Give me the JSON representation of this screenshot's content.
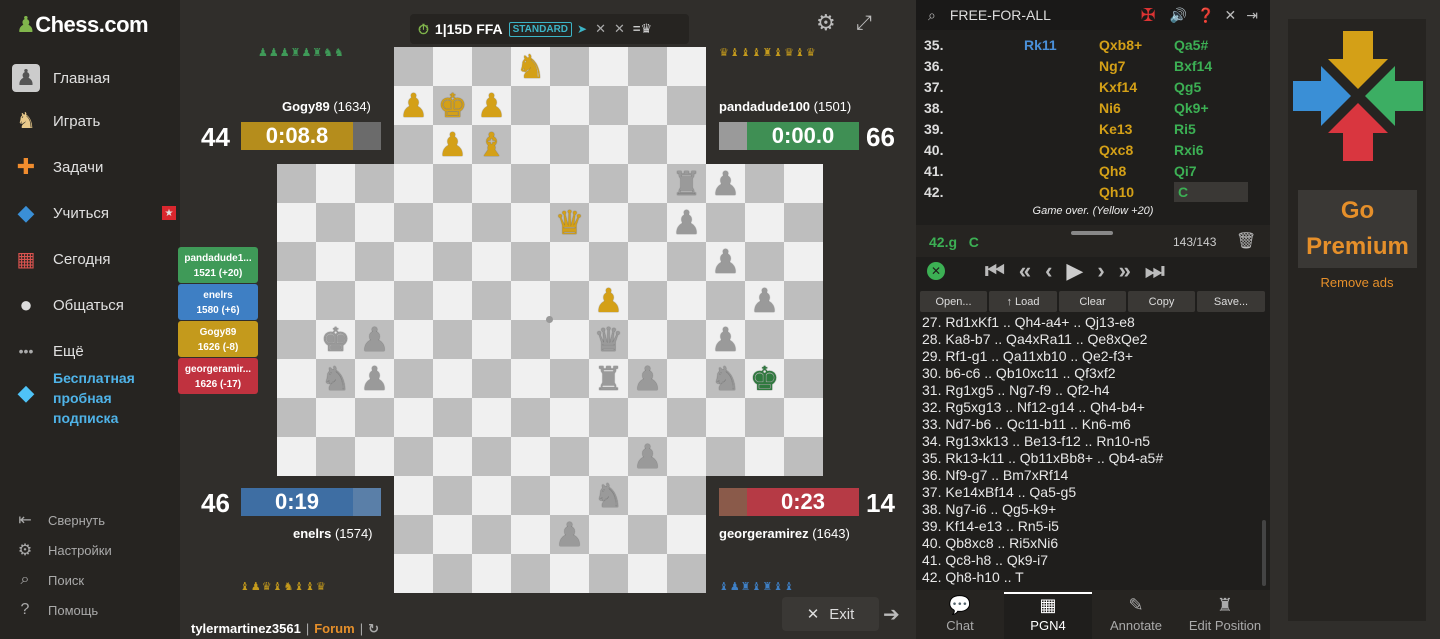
{
  "sidebar": {
    "logo": "Chess.com",
    "items": [
      {
        "label": "Главная",
        "icon": "home-icon"
      },
      {
        "label": "Играть",
        "icon": "play-icon"
      },
      {
        "label": "Задачи",
        "icon": "puzzle-icon"
      },
      {
        "label": "Учиться",
        "icon": "learn-icon"
      },
      {
        "label": "Сегодня",
        "icon": "today-icon"
      },
      {
        "label": "Общаться",
        "icon": "social-icon"
      },
      {
        "label": "Ещё",
        "icon": "more-icon"
      }
    ],
    "premium_label": "Бесплатная пробная подписка",
    "bottom": [
      {
        "label": "Свернуть",
        "icon": "collapse-icon"
      },
      {
        "label": "Настройки",
        "icon": "settings-icon"
      },
      {
        "label": "Поиск",
        "icon": "search-icon"
      },
      {
        "label": "Помощь",
        "icon": "help-icon"
      }
    ]
  },
  "game_header": {
    "title": "1|15D FFA",
    "badge": "STANDARD",
    "suffix": "=♛"
  },
  "players": {
    "top_left": {
      "name": "Gogy89",
      "rating": "(1634)",
      "score": "44",
      "clock": "0:08.8",
      "color": "#b58d1c"
    },
    "top_right": {
      "name": "pandadude100",
      "rating": "(1501)",
      "score": "66",
      "clock": "0:00.0",
      "color": "#3f8f54"
    },
    "bottom_left": {
      "name": "enelrs",
      "rating": "(1574)",
      "score": "46",
      "clock": "0:19",
      "color": "#3e6ea3"
    },
    "bottom_right": {
      "name": "georgeramirez",
      "rating": "(1643)",
      "score": "14",
      "clock": "0:23",
      "color": "#b63a45"
    }
  },
  "rankings": [
    {
      "name": "pandadude1...",
      "result": "1521 (+20)",
      "color": "#3f9a58"
    },
    {
      "name": "enelrs",
      "result": "1580 (+6)",
      "color": "#3e7fc4"
    },
    {
      "name": "Gogy89",
      "result": "1626 (-8)",
      "color": "#c49a1c"
    },
    {
      "name": "georgeramir...",
      "result": "1626 (-17)",
      "color": "#c0323f"
    }
  ],
  "material_rows": {
    "top_left": "♟♟♟♜♟♜♞♞",
    "top_right": "♛♝♝♝♜♝♛♝♛",
    "bottom_left": "♝♟♛♝♞♝♝♛",
    "bottom_right": "♝♟♜♝♜♝♝"
  },
  "footer": {
    "username": "tylermartinez3561",
    "separator": "|",
    "forum": "Forum",
    "exit": "Exit"
  },
  "right_panel": {
    "mode": "FREE-FOR-ALL",
    "moves": [
      {
        "n": "35.",
        "b": "Rk11",
        "y": "Qxb8+",
        "g": "Qa5#"
      },
      {
        "n": "36.",
        "b": "",
        "y": "Ng7",
        "g": "Bxf14"
      },
      {
        "n": "37.",
        "b": "",
        "y": "Kxf14",
        "g": "Qg5"
      },
      {
        "n": "38.",
        "b": "",
        "y": "Ni6",
        "g": "Qk9+"
      },
      {
        "n": "39.",
        "b": "",
        "y": "Ke13",
        "g": "Ri5"
      },
      {
        "n": "40.",
        "b": "",
        "y": "Qxc8",
        "g": "Rxi6"
      },
      {
        "n": "41.",
        "b": "",
        "y": "Qh8",
        "g": "Qi7"
      },
      {
        "n": "42.",
        "b": "",
        "y": "Qh10",
        "g": "C"
      }
    ],
    "game_over": "Game over. (Yellow +20)",
    "current_move": "42.g",
    "current_val": "C",
    "counter": "143/143",
    "buttons": [
      "Open...",
      "↑ Load",
      "Clear",
      "Copy",
      "Save..."
    ],
    "pgn": [
      "27. Rd1xKf1 .. Qh4-a4+ .. Qj13-e8",
      "28. Ka8-b7 .. Qa4xRa11 .. Qe8xQe2",
      "29. Rf1-g1 .. Qa11xb10 .. Qe2-f3+",
      "30. b6-c6 .. Qb10xc11 .. Qf3xf2",
      "31. Rg1xg5 .. Ng7-f9 .. Qf2-h4",
      "32. Rg5xg13 .. Nf12-g14 .. Qh4-b4+",
      "33. Nd7-b6 .. Qc11-b11 .. Kn6-m6",
      "34. Rg13xk13 .. Be13-f12 .. Rn10-n5",
      "35. Rk13-k11 .. Qb11xBb8+ .. Qb4-a5#",
      "36. Nf9-g7 .. Bm7xRf14",
      "37. Ke14xBf14 .. Qa5-g5",
      "38. Ng7-i6 .. Qg5-k9+",
      "39. Kf14-e13 .. Rn5-i5",
      "40. Qb8xc8 .. Ri5xNi6",
      "41. Qc8-h8 .. Qk9-i7",
      "42. Qh8-h10 .. T"
    ],
    "tabs": [
      {
        "label": "Chat",
        "icon": "chat-icon"
      },
      {
        "label": "PGN4",
        "icon": "board-icon"
      },
      {
        "label": "Annotate",
        "icon": "annotate-icon"
      },
      {
        "label": "Edit Position",
        "icon": "edit-position-icon"
      }
    ]
  },
  "ad": {
    "line1": "Go",
    "line2": "Premium",
    "remove": "Remove ads"
  }
}
